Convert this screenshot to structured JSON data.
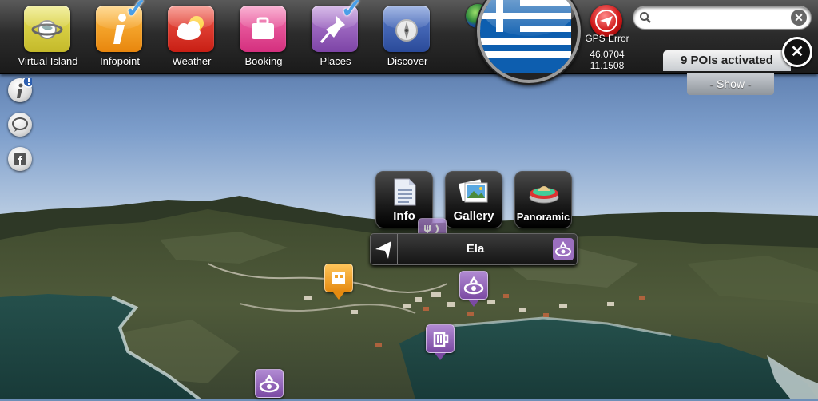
{
  "toolbar": {
    "buttons": [
      {
        "label": "Virtual Island",
        "color": "#d9d23a",
        "icon": "globe-ring-icon"
      },
      {
        "label": "Infopoint",
        "color": "#f5a21a",
        "icon": "info-i-icon",
        "checked": true
      },
      {
        "label": "Weather",
        "color": "#e8382e",
        "icon": "cloud-sun-icon"
      },
      {
        "label": "Booking",
        "color": "#e8509a",
        "icon": "suitcase-icon"
      },
      {
        "label": "Places",
        "color": "#9a5ebd",
        "icon": "pin-icon",
        "checked": true
      },
      {
        "label": "Discover",
        "color": "#3b5fb3",
        "icon": "compass-icon"
      }
    ],
    "flag": "greece-flag",
    "gps": {
      "label": "GPS Error",
      "lat": "46.0704",
      "lon": "11.1508"
    },
    "search": {
      "value": "",
      "placeholder": ""
    }
  },
  "poi": {
    "count_label": "9 POIs activated",
    "show_label": "- Show -",
    "close_label": "✕"
  },
  "side": [
    "info-icon",
    "chat-bubble-icon",
    "facebook-icon"
  ],
  "popup": {
    "buttons": [
      "Info",
      "Gallery",
      "Panoramic"
    ],
    "name": "Ela"
  },
  "colors": {
    "poi_purple": "#8e5db7",
    "poi_orange": "#f2a22a",
    "toolbar_bg": "#2c2c2c"
  }
}
